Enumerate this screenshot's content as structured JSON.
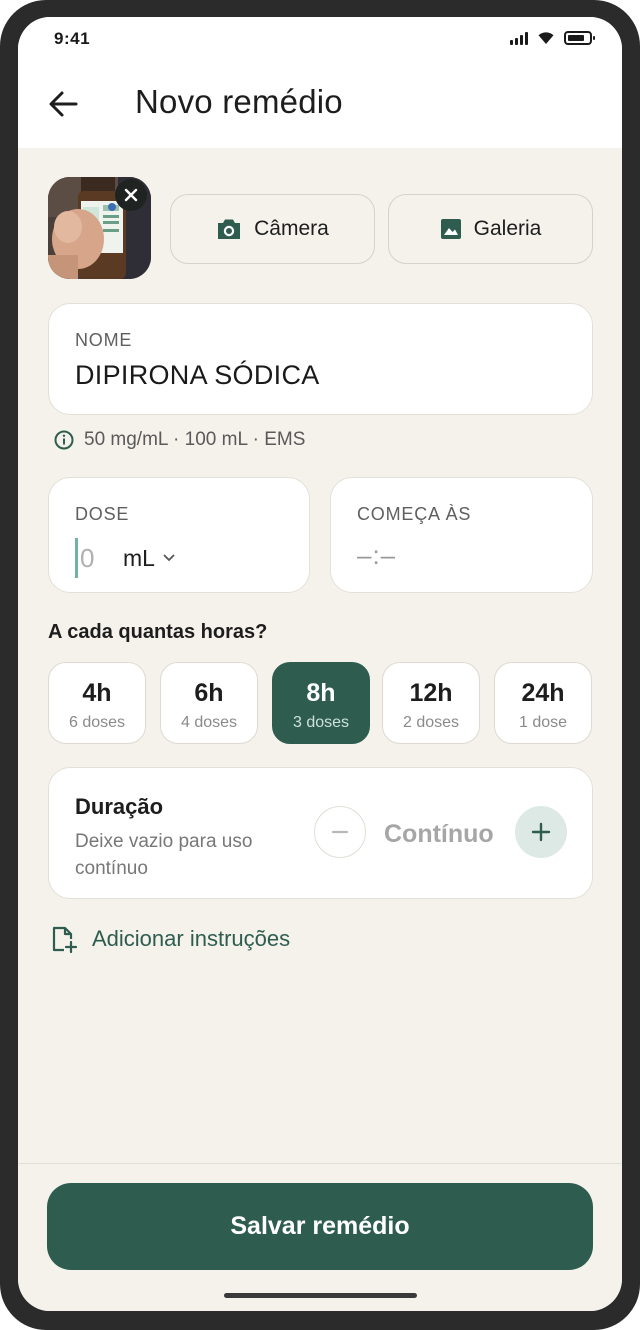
{
  "status": {
    "time": "9:41"
  },
  "header": {
    "title": "Novo remédio"
  },
  "photo": {
    "alt": "Frasco de remédio"
  },
  "buttons": {
    "camera": "Câmera",
    "gallery": "Galeria"
  },
  "name_field": {
    "label": "NOME",
    "value": "DIPIRONA SÓDICA"
  },
  "info": "50 mg/mL · 100 mL · EMS",
  "dose_field": {
    "label": "DOSE",
    "placeholder": "0",
    "unit": "mL"
  },
  "start_field": {
    "label": "COMEÇA ÀS",
    "value": "–:–"
  },
  "interval": {
    "question": "A cada quantas horas?",
    "options": [
      {
        "hours": "4h",
        "doses": "6 doses"
      },
      {
        "hours": "6h",
        "doses": "4 doses"
      },
      {
        "hours": "8h",
        "doses": "3 doses"
      },
      {
        "hours": "12h",
        "doses": "2 doses"
      },
      {
        "hours": "24h",
        "doses": "1 dose"
      }
    ],
    "selected": "8h"
  },
  "duration": {
    "title": "Duração",
    "subtitle": "Deixe vazio para uso contínuo",
    "value": "Contínuo"
  },
  "add_instructions": "Adicionar instruções",
  "save_button": "Salvar remédio",
  "colors": {
    "primary": "#2e5d50",
    "background": "#f5f2ec",
    "accent_light": "#dde9e4"
  }
}
